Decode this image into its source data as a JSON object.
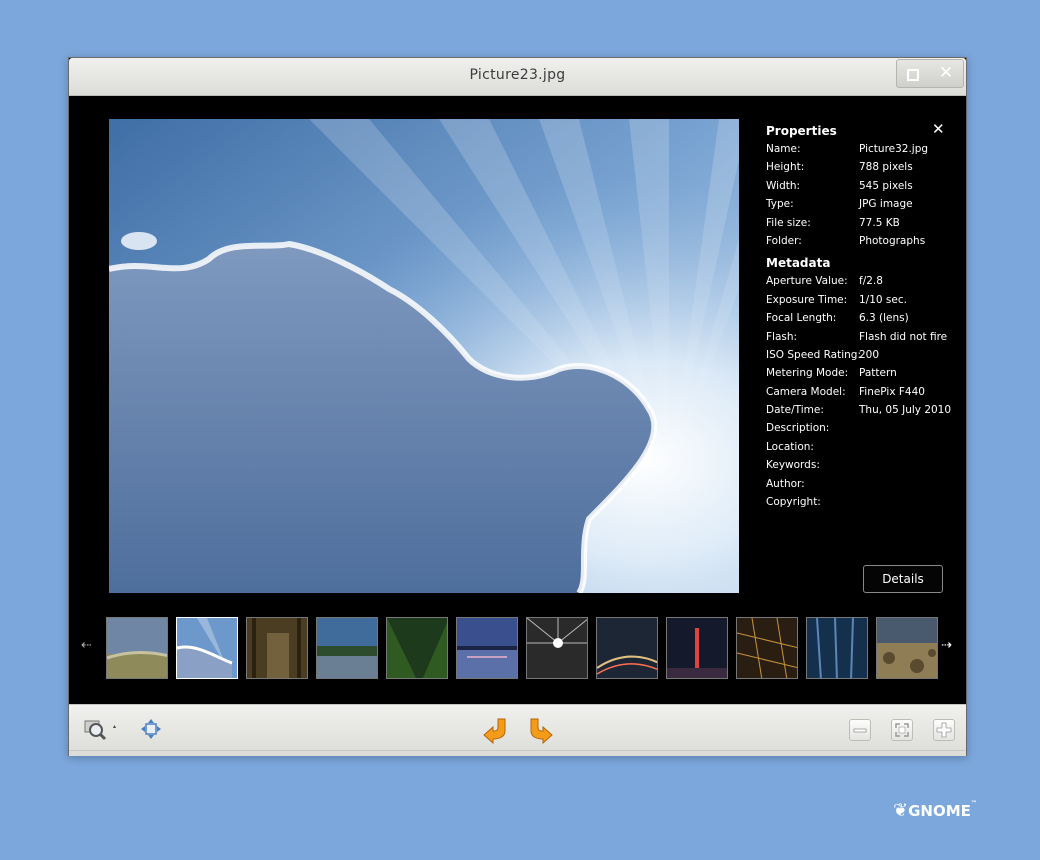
{
  "window": {
    "title": "Picture23.jpg"
  },
  "properties": {
    "title": "Properties",
    "rows": [
      {
        "label": "Name:",
        "value": "Picture32.jpg"
      },
      {
        "label": "Height:",
        "value": "788 pixels"
      },
      {
        "label": "Width:",
        "value": "545 pixels"
      },
      {
        "label": "Type:",
        "value": "JPG image"
      },
      {
        "label": "File size:",
        "value": "77.5 KB"
      },
      {
        "label": "Folder:",
        "value": "Photographs"
      }
    ]
  },
  "metadata": {
    "title": "Metadata",
    "rows": [
      {
        "label": "Aperture Value:",
        "value": "f/2.8"
      },
      {
        "label": "Exposure Time:",
        "value": "1/10 sec."
      },
      {
        "label": "Focal Length:",
        "value": "6.3 (lens)"
      },
      {
        "label": "Flash:",
        "value": "Flash did not fire"
      },
      {
        "label": "ISO Speed Rating:",
        "value": "200"
      },
      {
        "label": "Metering Mode:",
        "value": "Pattern"
      },
      {
        "label": "Camera Model:",
        "value": "FinePix F440"
      },
      {
        "label": "Date/Time:",
        "value": "Thu, 05 July 2010"
      },
      {
        "label": "Description:",
        "value": ""
      },
      {
        "label": "Location:",
        "value": ""
      },
      {
        "label": "Keywords:",
        "value": ""
      },
      {
        "label": "Author:",
        "value": ""
      },
      {
        "label": "Copyright:",
        "value": ""
      }
    ]
  },
  "details_label": "Details",
  "close_glyph": "✕",
  "thumbnails": [
    {
      "name": "grass",
      "selected": false
    },
    {
      "name": "sky-clouds",
      "selected": true
    },
    {
      "name": "forest-path",
      "selected": false
    },
    {
      "name": "lake-shore",
      "selected": false
    },
    {
      "name": "green-valley",
      "selected": false
    },
    {
      "name": "city-water-dusk",
      "selected": false
    },
    {
      "name": "light-rays",
      "selected": false
    },
    {
      "name": "highway-night",
      "selected": false
    },
    {
      "name": "city-tower-night",
      "selected": false
    },
    {
      "name": "city-lights-aerial",
      "selected": false
    },
    {
      "name": "blue-trees",
      "selected": false
    },
    {
      "name": "desert-shrubs",
      "selected": false
    }
  ],
  "strip": {
    "prev_glyph": "⇠",
    "next_glyph": "⇢"
  },
  "branding": {
    "logo_text": "GNOME",
    "tm": "™"
  },
  "colors": {
    "desktop": "#7ba7dc",
    "accent_arrows": "#f59b1a"
  }
}
